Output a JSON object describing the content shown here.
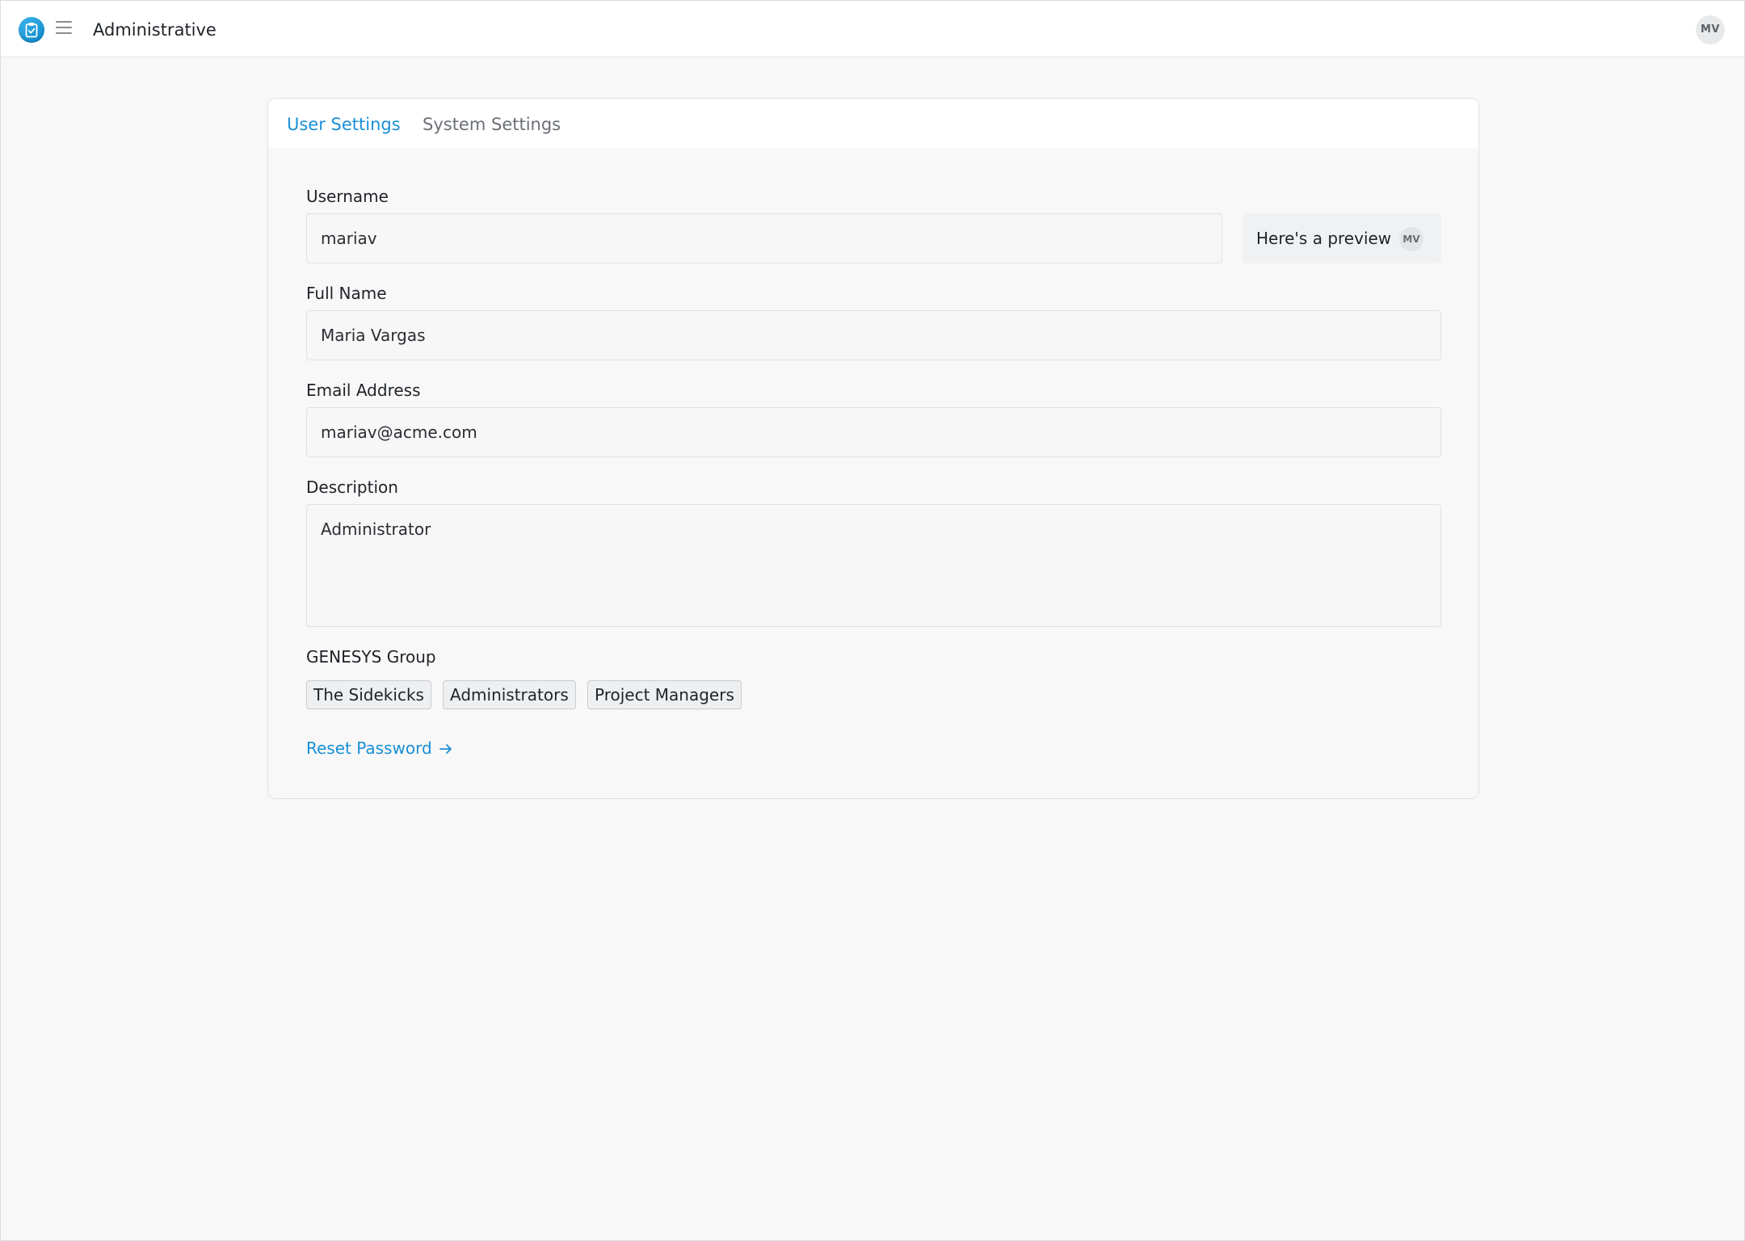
{
  "header": {
    "app_icon": "clipboard-check-icon",
    "menu_icon": "hamburger-menu-icon",
    "title": "Administrative",
    "user_initials": "MV"
  },
  "tabs": [
    {
      "label": "User Settings",
      "active": true
    },
    {
      "label": "System Settings",
      "active": false
    }
  ],
  "form": {
    "username": {
      "label": "Username",
      "value": "mariav"
    },
    "full_name": {
      "label": "Full Name",
      "value": "Maria Vargas"
    },
    "email": {
      "label": "Email Address",
      "value": "mariav@acme.com"
    },
    "description": {
      "label": "Description",
      "value": "Administrator"
    },
    "groups": {
      "label": "GENESYS Group",
      "items": [
        "The Sidekicks",
        "Administrators",
        "Project Managers"
      ]
    },
    "preview": {
      "text": "Here's a preview",
      "initials": "MV"
    },
    "reset_password": {
      "label": "Reset Password",
      "icon": "arrow-right-icon"
    }
  },
  "colors": {
    "accent": "#1a8fd6",
    "background": "#f8f8f8",
    "surface": "#ffffff"
  }
}
